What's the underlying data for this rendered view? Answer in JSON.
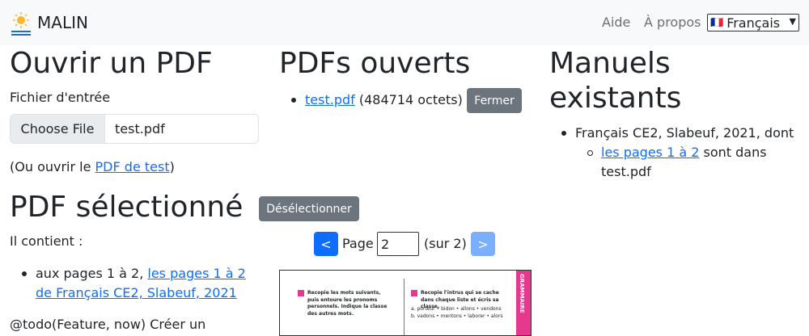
{
  "navbar": {
    "brand": "MALIN",
    "links": [
      "Aide",
      "À propos"
    ],
    "language": {
      "flag": "🇫🇷",
      "selected": "Français"
    }
  },
  "open_pdf": {
    "title": "Ouvrir un PDF",
    "input_label": "Fichier d'entrée",
    "choose_file": "Choose File",
    "file_name": "test.pdf",
    "or_open_prefix": "(Ou ouvrir le ",
    "test_pdf_link": "PDF de test",
    "or_open_suffix": ")"
  },
  "opened_pdfs": {
    "title": "PDFs ouverts",
    "items": [
      {
        "name": "test.pdf",
        "size": "(484714 octets)",
        "close_label": "Fermer"
      }
    ]
  },
  "manuals": {
    "title_line1": "Manuels",
    "title_line2": "existants",
    "items": [
      {
        "label": "Français CE2, Slabeuf, 2021, dont",
        "sub": {
          "link": "les pages 1 à 2",
          "text_line1": " sont dans",
          "text_line2": "test.pdf"
        }
      }
    ]
  },
  "selected_pdf": {
    "title": "PDF sélectionné",
    "deselect_label": "Désélectionner",
    "contains_label": "Il contient :",
    "item_prefix": "aux pages 1 à 2, ",
    "item_link_line1": "les pages 1 à 2",
    "item_link_line2": "de Français CE2, Slabeuf, 2021",
    "todo_text": "@todo(Feature, now) Créer un"
  },
  "pager": {
    "prev": "<",
    "page_label": "Page",
    "page_value": "2",
    "total": "(sur 2)",
    "next": ">"
  },
  "preview": {
    "left_title": "Recopie les mots suivants, puis entoure les pronoms personnels. Indique la classe des autres mots.",
    "right_title": "Recopie l'intrus qui se cache dans chaque liste et écris sa classe.",
    "right_lines": [
      "a. porteur • bidon • allons • vendons",
      "b. vadons • mentons • laborer • alors"
    ],
    "side_tab": "GRAMMAIRE",
    "accent": "#e6398e"
  }
}
